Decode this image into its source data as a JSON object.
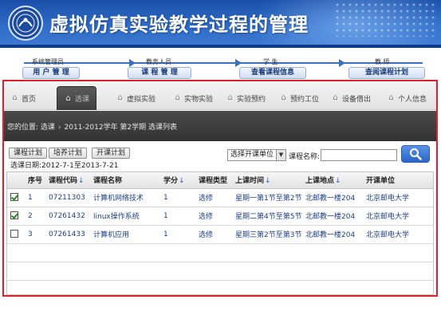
{
  "banner": {
    "title": "虚拟仿真实验教学过程的管理"
  },
  "roles": [
    {
      "role": "系统管理员",
      "button": "用 户 管 理"
    },
    {
      "role": "教务人员",
      "button": "课 程 管 理"
    },
    {
      "role": "学 生",
      "button": "查看课程信息"
    },
    {
      "role": "教 师",
      "button": "查阅课程计划"
    }
  ],
  "nav": {
    "tabs": [
      {
        "label": "首页",
        "icon": "home-icon",
        "active": false
      },
      {
        "label": "选课",
        "icon": "home-icon",
        "active": true
      },
      {
        "label": "虚拟实验",
        "icon": "home-icon",
        "active": false
      },
      {
        "label": "实物实验",
        "icon": "home-icon",
        "active": false
      },
      {
        "label": "实验预约",
        "icon": "home-icon",
        "active": false
      },
      {
        "label": "预约工位",
        "icon": "home-icon",
        "active": false
      },
      {
        "label": "设备借出",
        "icon": "home-icon",
        "active": false
      },
      {
        "label": "个人信息",
        "icon": "home-icon",
        "active": false
      }
    ]
  },
  "breadcrumb": {
    "prefix": "您的位置: 选课",
    "current": "2011-2012学年 第2学期 选课列表"
  },
  "toolbar": {
    "buttons": [
      "课程计划",
      "培养计划",
      "开课计划"
    ],
    "date_range": "选课日期:2012-7-1至2013-7-21",
    "select_value": "选择开课单位",
    "search_label": "课程名称:",
    "search_value": "",
    "search_icon": "search-icon"
  },
  "table": {
    "headers": [
      "序号",
      "课程代码",
      "课程名称",
      "学分",
      "课程类型",
      "上课时间",
      "上课地点",
      "开课单位"
    ],
    "rows": [
      {
        "checked": true,
        "index": "1",
        "code": "07211303",
        "name": "计算机网络技术",
        "credit": "1",
        "type": "选修",
        "time": "星期一第1节至第2节",
        "place": "北邮教一楼204",
        "unit": "北京邮电大学"
      },
      {
        "checked": true,
        "index": "2",
        "code": "07261432",
        "name": "linux操作系统",
        "credit": "1",
        "type": "选修",
        "time": "星期二第4节至第5节",
        "place": "北邮教一楼204",
        "unit": "北京邮电大学"
      },
      {
        "checked": false,
        "index": "3",
        "code": "07261433",
        "name": "计算机应用",
        "credit": "1",
        "type": "选修",
        "time": "星期三第2节至第3节",
        "place": "北邮教一楼204",
        "unit": "北京邮电大学"
      }
    ]
  },
  "colors": {
    "frame": "#e0202a",
    "banner": "#2f6cc8",
    "link": "#1e3f86"
  }
}
